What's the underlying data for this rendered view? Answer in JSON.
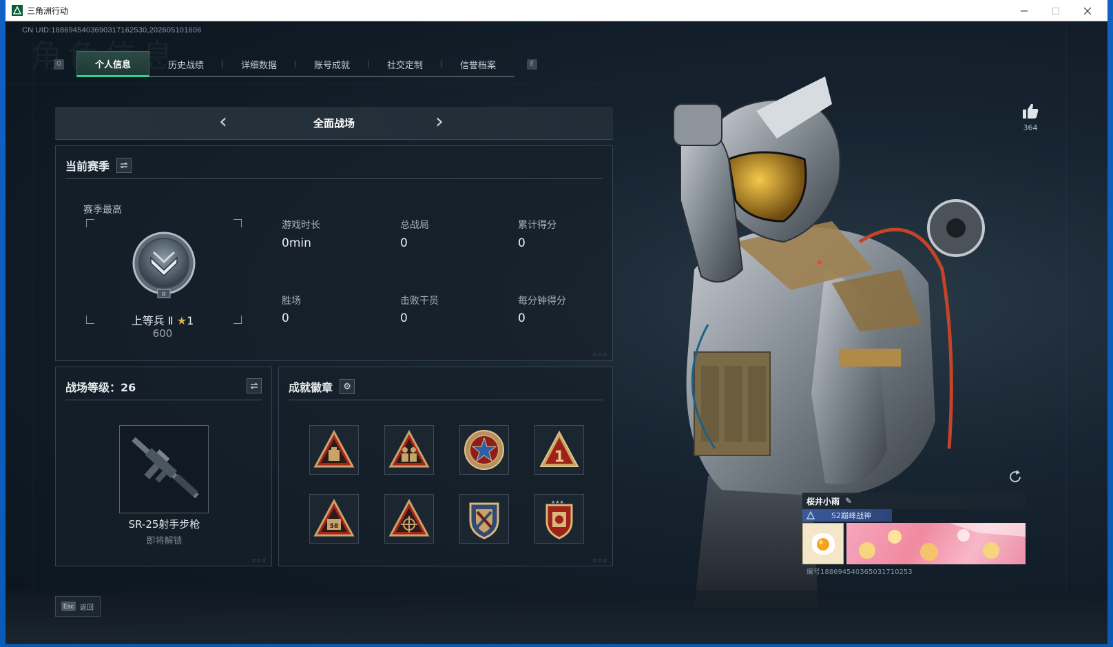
{
  "window": {
    "title": "三角洲行动",
    "controls": [
      "minimize",
      "maximize",
      "close"
    ]
  },
  "uid_text": "CN UID:1886945403690317162530,202605101606",
  "bg_title": "角色信息",
  "tabs": {
    "prev_key": "Q",
    "next_key": "E",
    "items": [
      {
        "label": "个人信息",
        "active": true
      },
      {
        "label": "历史战绩",
        "active": false
      },
      {
        "label": "详细数据",
        "active": false
      },
      {
        "label": "账号成就",
        "active": false
      },
      {
        "label": "社交定制",
        "active": false
      },
      {
        "label": "信誉档案",
        "active": false
      }
    ]
  },
  "mode": {
    "title": "全面战场",
    "prev": "‹",
    "next": "›"
  },
  "season": {
    "title": "当前赛季",
    "best_label": "赛季最高",
    "rank_name": "上等兵 Ⅱ",
    "rank_stars": "1",
    "rank_score": "600",
    "stats": [
      {
        "label": "游戏时长",
        "value": "0min"
      },
      {
        "label": "总战局",
        "value": "0"
      },
      {
        "label": "累计得分",
        "value": "0"
      },
      {
        "label": "胜场",
        "value": "0"
      },
      {
        "label": "击败干员",
        "value": "0"
      },
      {
        "label": "每分钟得分",
        "value": "0"
      }
    ]
  },
  "level": {
    "title": "战场等级：26",
    "weapon_name": "SR-25射手步枪",
    "weapon_status": "即将解锁"
  },
  "badges": {
    "title": "成就徽章",
    "items": [
      {
        "icon": "triangle-badge-bag"
      },
      {
        "icon": "triangle-badge-soldiers"
      },
      {
        "icon": "star-round-badge"
      },
      {
        "icon": "triangle-badge-number-1"
      },
      {
        "icon": "triangle-badge-58"
      },
      {
        "icon": "triangle-badge-target"
      },
      {
        "icon": "shield-badge-wrench"
      },
      {
        "icon": "shield-badge-stars"
      }
    ]
  },
  "likes": {
    "count": "364"
  },
  "card": {
    "name": "桜井小雨",
    "title_tag": "S2巅峰战神",
    "number": "编号188694540365031710253"
  },
  "footer": {
    "esc_key": "Esc",
    "esc_label": "返回"
  },
  "colors": {
    "accent": "#2fd39a",
    "badge_gold": "#c8a46a",
    "badge_red": "#a8241c",
    "desktop_blue": "#0a5bb8"
  }
}
